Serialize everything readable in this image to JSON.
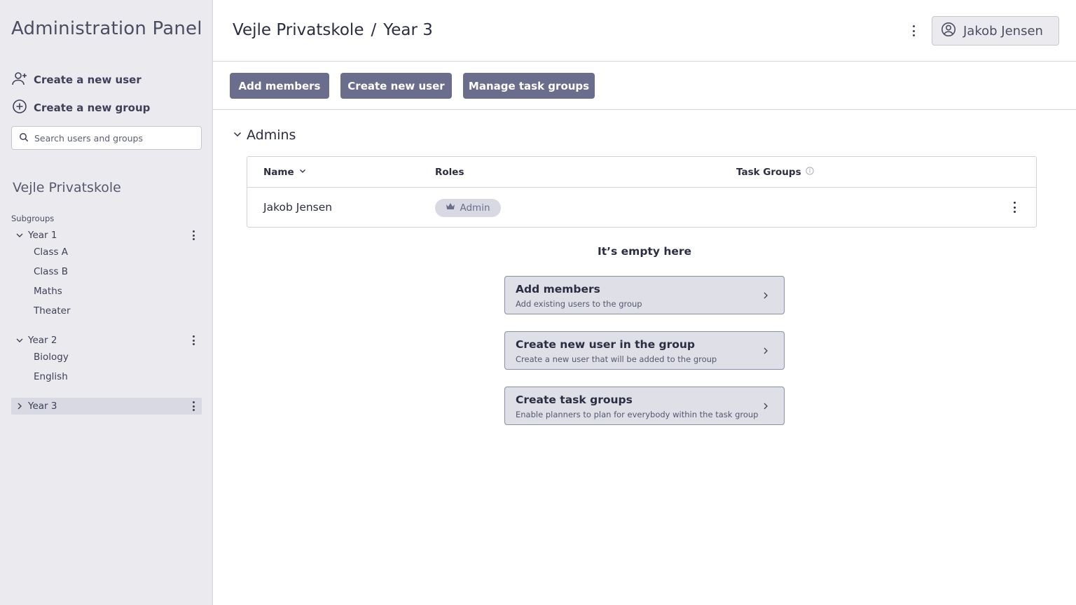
{
  "sidebar": {
    "title": "Administration Panel",
    "create_user_label": "Create a new user",
    "create_group_label": "Create a new group",
    "search_placeholder": "Search users and groups",
    "org_name": "Vejle Privatskole",
    "subgroups_label": "Subgroups",
    "groups": [
      {
        "label": "Year 1",
        "expanded": true,
        "children": [
          "Class A",
          "Class B",
          "Maths",
          "Theater"
        ]
      },
      {
        "label": "Year 2",
        "expanded": true,
        "children": [
          "Biology",
          "English"
        ]
      },
      {
        "label": "Year 3",
        "expanded": false,
        "selected": true,
        "children": []
      }
    ]
  },
  "header": {
    "breadcrumb_org": "Vejle Privatskole",
    "breadcrumb_sep": "/",
    "breadcrumb_group": "Year 3",
    "user_name": "Jakob Jensen"
  },
  "toolbar": {
    "add_members": "Add members",
    "create_user": "Create new user",
    "manage_task_groups": "Manage task groups"
  },
  "admins": {
    "section_title": "Admins",
    "columns": {
      "name": "Name",
      "roles": "Roles",
      "task_groups": "Task Groups"
    },
    "rows": [
      {
        "name": "Jakob Jensen",
        "role": "Admin"
      }
    ]
  },
  "empty_state": {
    "title": "It’s empty here",
    "cards": [
      {
        "title": "Add members",
        "subtitle": "Add existing users to the group"
      },
      {
        "title": "Create new user in the group",
        "subtitle": "Create a new user that will be added to the group"
      },
      {
        "title": "Create task groups",
        "subtitle": "Enable planners to plan for everybody within the task group"
      }
    ]
  },
  "colors": {
    "sidebar_bg": "#ebebef",
    "primary_button": "#6a6e8c",
    "selected_row": "#d8d9e2",
    "card_bg": "#dedfe7"
  }
}
